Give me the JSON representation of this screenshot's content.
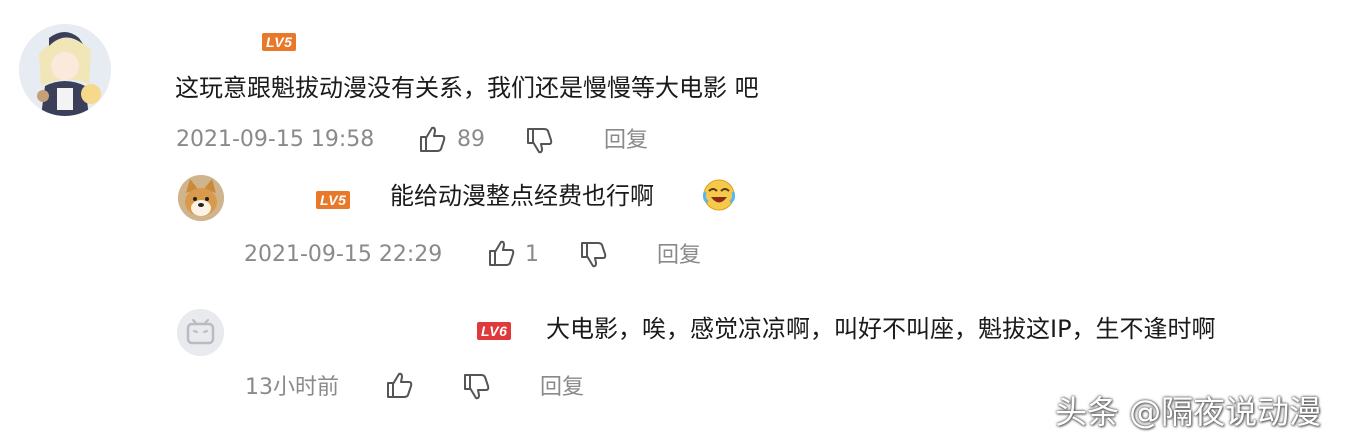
{
  "comments": [
    {
      "level": "LV5",
      "level_color": "#e8782a",
      "text": "这玩意跟魁拔动漫没有关系，我们还是慢慢等大电影 吧",
      "time": "2021-09-15 19:58",
      "likes": "89",
      "reply_label": "回复",
      "avatar_icon": "anime-girl-avatar"
    },
    {
      "level": "LV5",
      "level_color": "#e8782a",
      "text": "能给动漫整点经费也行啊",
      "emoji_icon": "crying-laughing-emoji",
      "time": "2021-09-15 22:29",
      "likes": "1",
      "reply_label": "回复",
      "avatar_icon": "shiba-dog-avatar"
    },
    {
      "level": "LV6",
      "level_color": "#e0393b",
      "text": "大电影，唉，感觉凉凉啊，叫好不叫座，魁拔这IP，生不逢时啊",
      "time": "13小时前",
      "reply_label": "回复",
      "avatar_icon": "bilibili-tv-avatar"
    }
  ],
  "watermark": "头条 @隔夜说动漫"
}
